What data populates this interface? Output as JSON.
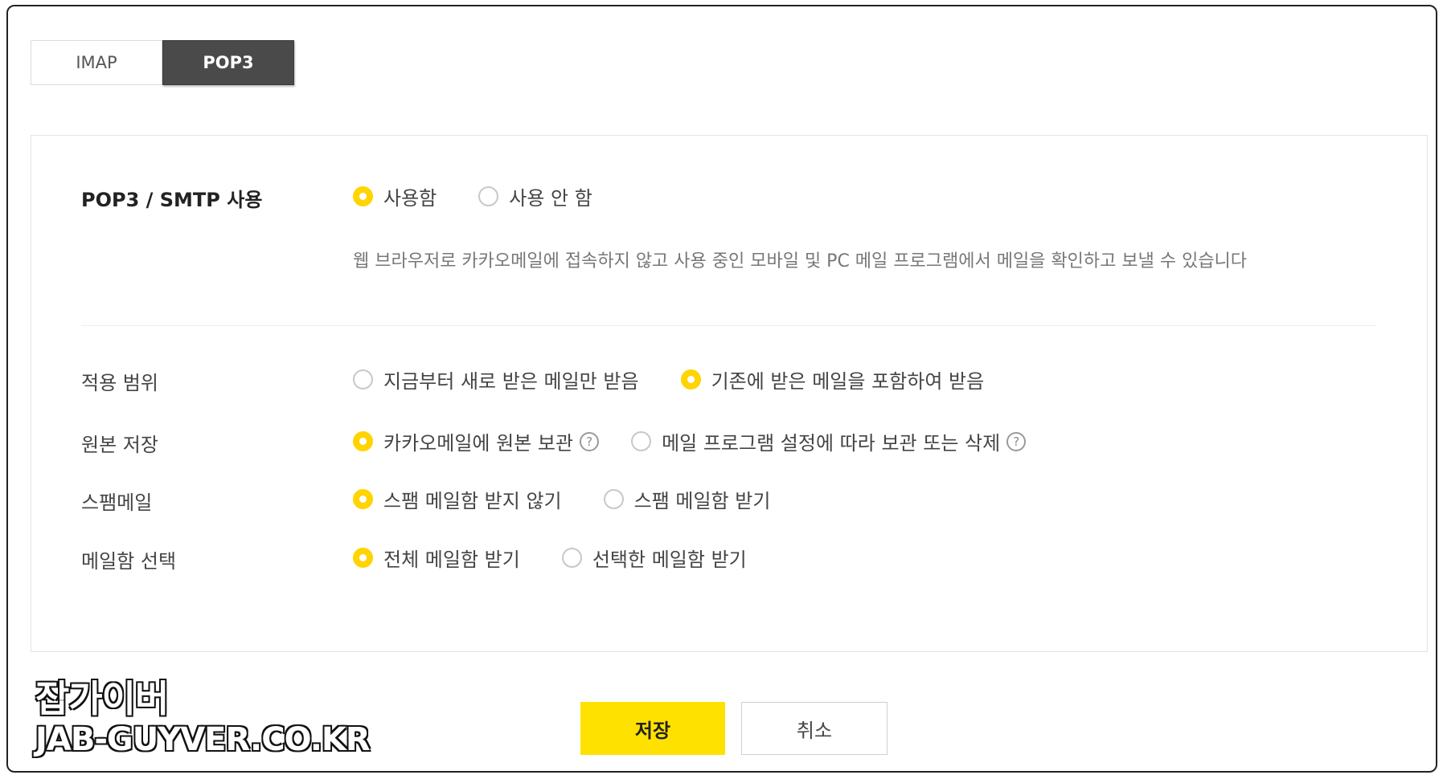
{
  "tabs": {
    "imap": "IMAP",
    "pop3": "POP3"
  },
  "settings": {
    "pop3_smtp": {
      "label": "POP3 / SMTP 사용",
      "options": [
        "사용함",
        "사용 안 함"
      ],
      "selected": "사용함",
      "description": "웹 브라우저로 카카오메일에 접속하지 않고 사용 중인 모바일 및 PC 메일 프로그램에서 메일을 확인하고 보낼 수 있습니다"
    },
    "scope": {
      "label": "적용 범위",
      "options": [
        "지금부터 새로 받은 메일만 받음",
        "기존에 받은 메일을 포함하여 받음"
      ],
      "selected": "기존에 받은 메일을 포함하여 받음"
    },
    "original": {
      "label": "원본 저장",
      "options": [
        "카카오메일에 원본 보관",
        "메일 프로그램 설정에 따라 보관 또는 삭제"
      ],
      "selected": "카카오메일에 원본 보관",
      "help_glyph": "?"
    },
    "spam": {
      "label": "스팸메일",
      "options": [
        "스팸 메일함 받지 않기",
        "스팸 메일함 받기"
      ],
      "selected": "스팸 메일함 받지 않기"
    },
    "mailbox": {
      "label": "메일함 선택",
      "options": [
        "전체 메일함 받기",
        "선택한 메일함 받기"
      ],
      "selected": "전체 메일함 받기"
    }
  },
  "buttons": {
    "save": "저장",
    "cancel": "취소"
  },
  "watermark": {
    "line1": "잡가이버",
    "line2": "JAB-GUYVER.CO.KR"
  },
  "colors": {
    "accent": "#ffd400",
    "save_button": "#ffe100",
    "active_tab": "#4a4a4a"
  }
}
